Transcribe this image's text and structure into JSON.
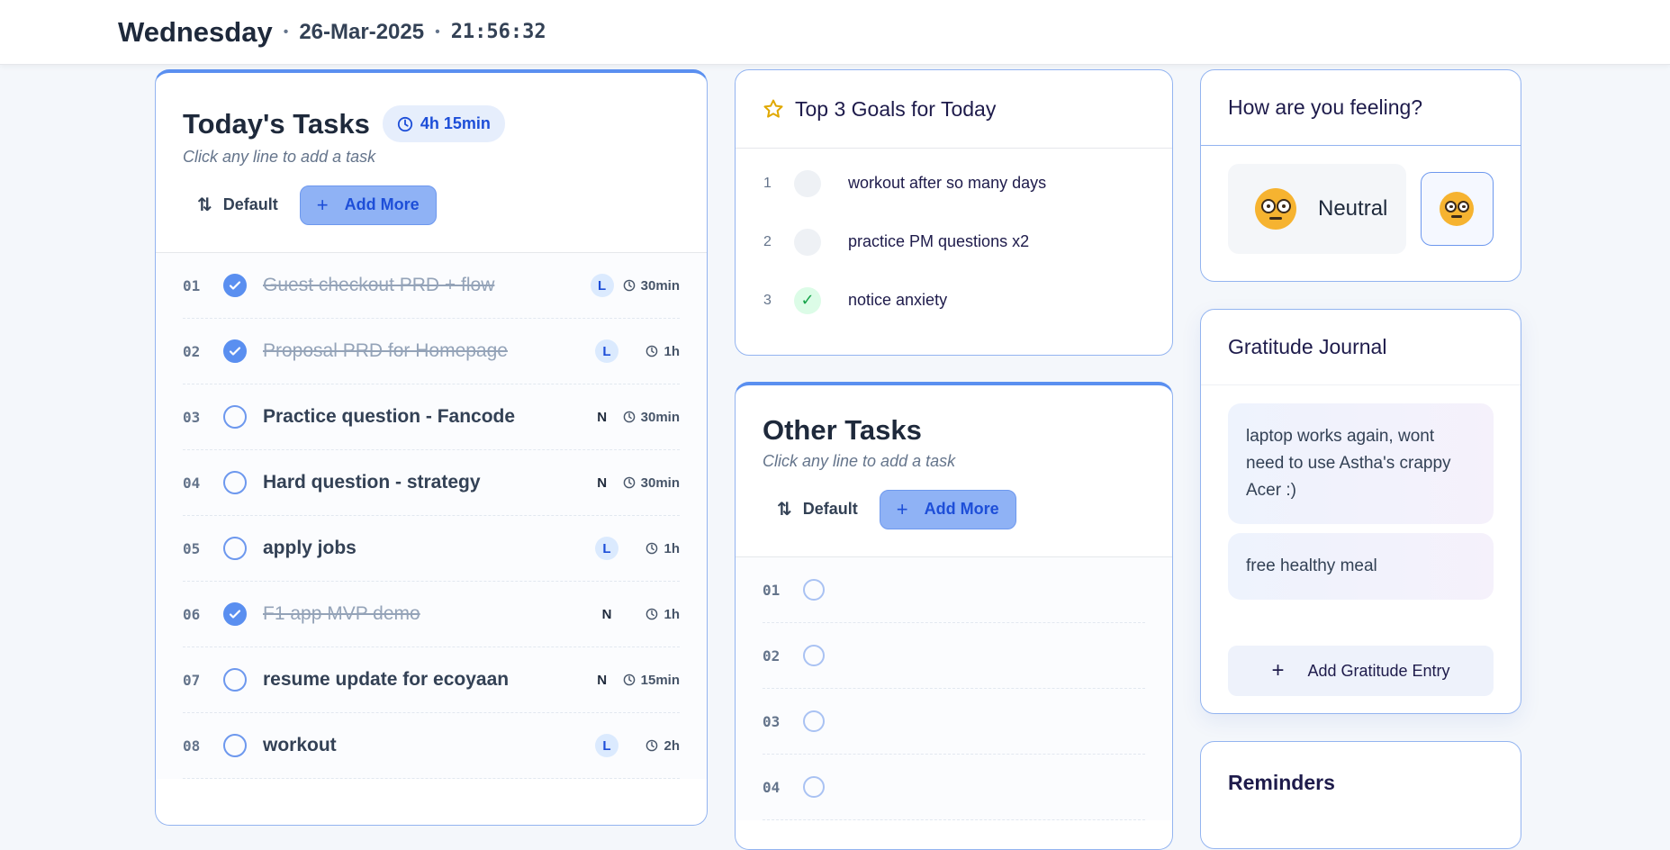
{
  "header": {
    "day": "Wednesday",
    "date": "26-Mar-2025",
    "time": "21:56:32"
  },
  "today_tasks": {
    "title": "Today's Tasks",
    "total_duration": "4h 15min",
    "hint": "Click any line to add a task",
    "sort_label": "Default",
    "add_label": "Add More",
    "tasks": [
      {
        "num": "01",
        "text": "Guest checkout PRD + flow",
        "done": true,
        "priority": "L",
        "duration": "30min"
      },
      {
        "num": "02",
        "text": "Proposal PRD for Homepage",
        "done": true,
        "priority": "L",
        "duration": "1h"
      },
      {
        "num": "03",
        "text": "Practice question - Fancode",
        "done": false,
        "priority": "N",
        "duration": "30min"
      },
      {
        "num": "04",
        "text": "Hard question - strategy",
        "done": false,
        "priority": "N",
        "duration": "30min"
      },
      {
        "num": "05",
        "text": "apply jobs",
        "done": false,
        "priority": "L",
        "duration": "1h"
      },
      {
        "num": "06",
        "text": "F1 app MVP demo",
        "done": true,
        "priority": "N",
        "duration": "1h"
      },
      {
        "num": "07",
        "text": "resume update for ecoyaan",
        "done": false,
        "priority": "N",
        "duration": "15min"
      },
      {
        "num": "08",
        "text": "workout",
        "done": false,
        "priority": "L",
        "duration": "2h"
      }
    ]
  },
  "goals": {
    "title": "Top 3 Goals for Today",
    "items": [
      {
        "num": "1",
        "text": "workout after so many days",
        "done": false
      },
      {
        "num": "2",
        "text": "practice PM questions x2",
        "done": false
      },
      {
        "num": "3",
        "text": "notice anxiety",
        "done": true
      }
    ],
    "check_glyph": "✓"
  },
  "other_tasks": {
    "title": "Other Tasks",
    "hint": "Click any line to add a task",
    "sort_label": "Default",
    "add_label": "Add More",
    "rows": [
      "01",
      "02",
      "03",
      "04"
    ]
  },
  "feeling": {
    "title": "How are you feeling?",
    "mood": "Neutral"
  },
  "gratitude": {
    "title": "Gratitude Journal",
    "entries": [
      "laptop works again, wont need to use Astha's crappy Acer :)",
      "free healthy meal"
    ],
    "add_label": "Add Gratitude Entry"
  },
  "reminders": {
    "title": "Reminders"
  },
  "colors": {
    "accent": "#5a8ff0",
    "card_border": "#93b4f0",
    "done_green": "#16a34a"
  },
  "icons": {
    "duration": "clock-icon",
    "sort": "sort-arrows-icon",
    "add": "plus-icon",
    "goals": "star-icon",
    "mood": "neutral-face-icon"
  }
}
